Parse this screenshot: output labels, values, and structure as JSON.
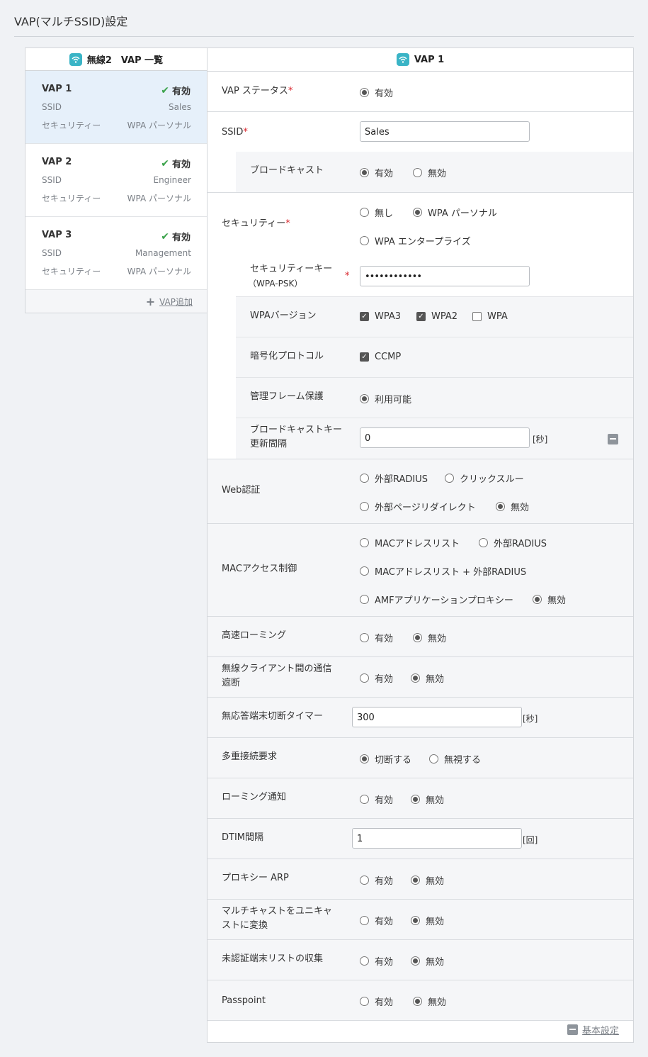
{
  "page": {
    "title": "VAP(マルチSSID)設定"
  },
  "left": {
    "header": "無線2　VAP 一覧",
    "ssid_label": "SSID",
    "security_label": "セキュリティー",
    "items": [
      {
        "name": "VAP 1",
        "status": "有効",
        "ssid": "Sales",
        "security": "WPA パーソナル"
      },
      {
        "name": "VAP 2",
        "status": "有効",
        "ssid": "Engineer",
        "security": "WPA パーソナル"
      },
      {
        "name": "VAP 3",
        "status": "有効",
        "ssid": "Management",
        "security": "WPA パーソナル"
      }
    ],
    "add_label": "VAP追加"
  },
  "right": {
    "header": "VAP 1",
    "vap_status": {
      "label": "VAP ステータス",
      "options": [
        "有効"
      ],
      "selected": "有効"
    },
    "ssid": {
      "label": "SSID",
      "value": "Sales"
    },
    "broadcast": {
      "label": "ブロードキャスト",
      "options": [
        "有効",
        "無効"
      ],
      "selected": "有効"
    },
    "security": {
      "label": "セキュリティー",
      "options": [
        "無し",
        "WPA パーソナル",
        "WPA エンタープライズ"
      ],
      "selected": "WPA パーソナル"
    },
    "security_key": {
      "label1": "セキュリティーキー",
      "label2": "（WPA-PSK）",
      "value": "••••••••••••"
    },
    "wpa_version": {
      "label": "WPAバージョン",
      "options": [
        "WPA3",
        "WPA2",
        "WPA"
      ],
      "checked": [
        "WPA3",
        "WPA2"
      ]
    },
    "cipher": {
      "label": "暗号化プロトコル",
      "options": [
        "CCMP"
      ],
      "checked": [
        "CCMP"
      ]
    },
    "pmf": {
      "label": "管理フレーム保護",
      "options": [
        "利用可能"
      ],
      "selected": "利用可能"
    },
    "bcast_key": {
      "label1": "ブロードキャストキー",
      "label2": "更新間隔",
      "value": "0",
      "unit": "[秒]"
    },
    "web_auth": {
      "label": "Web認証",
      "options": [
        "外部RADIUS",
        "クリックスルー",
        "外部ページリダイレクト",
        "無効"
      ],
      "selected": "無効"
    },
    "mac_acl": {
      "label": "MACアクセス制御",
      "options": [
        "MACアドレスリスト",
        "外部RADIUS",
        "MACアドレスリスト + 外部RADIUS",
        "AMFアプリケーションプロキシー",
        "無効"
      ],
      "selected": "無効"
    },
    "fast_roaming": {
      "label": "高速ローミング",
      "options": [
        "有効",
        "無効"
      ],
      "selected": "無効"
    },
    "client_isolation": {
      "label1": "無線クライアント間の通信",
      "label2": "遮断",
      "options": [
        "有効",
        "無効"
      ],
      "selected": "無効"
    },
    "idle_timer": {
      "label": "無応答端末切断タイマー",
      "value": "300",
      "unit": "[秒]"
    },
    "multi_conn": {
      "label": "多重接続要求",
      "options": [
        "切断する",
        "無視する"
      ],
      "selected": "切断する"
    },
    "roaming_notify": {
      "label": "ローミング通知",
      "options": [
        "有効",
        "無効"
      ],
      "selected": "無効"
    },
    "dtim": {
      "label": "DTIM間隔",
      "value": "1",
      "unit": "[回]"
    },
    "proxy_arp": {
      "label": "プロキシー ARP",
      "options": [
        "有効",
        "無効"
      ],
      "selected": "無効"
    },
    "mc2uc": {
      "label1": "マルチキャストをユニキャ",
      "label2": "ストに変換",
      "options": [
        "有効",
        "無効"
      ],
      "selected": "無効"
    },
    "unauth_list": {
      "label": "未認証端末リストの収集",
      "options": [
        "有効",
        "無効"
      ],
      "selected": "無効"
    },
    "passpoint": {
      "label": "Passpoint",
      "options": [
        "有効",
        "無効"
      ],
      "selected": "無効"
    },
    "basic_settings_label": "基本設定"
  },
  "colors": {
    "accent": "#3ab4c6",
    "active_bg": "#e6f0fa",
    "check": "#3aa24a",
    "required": "#d9252c"
  }
}
